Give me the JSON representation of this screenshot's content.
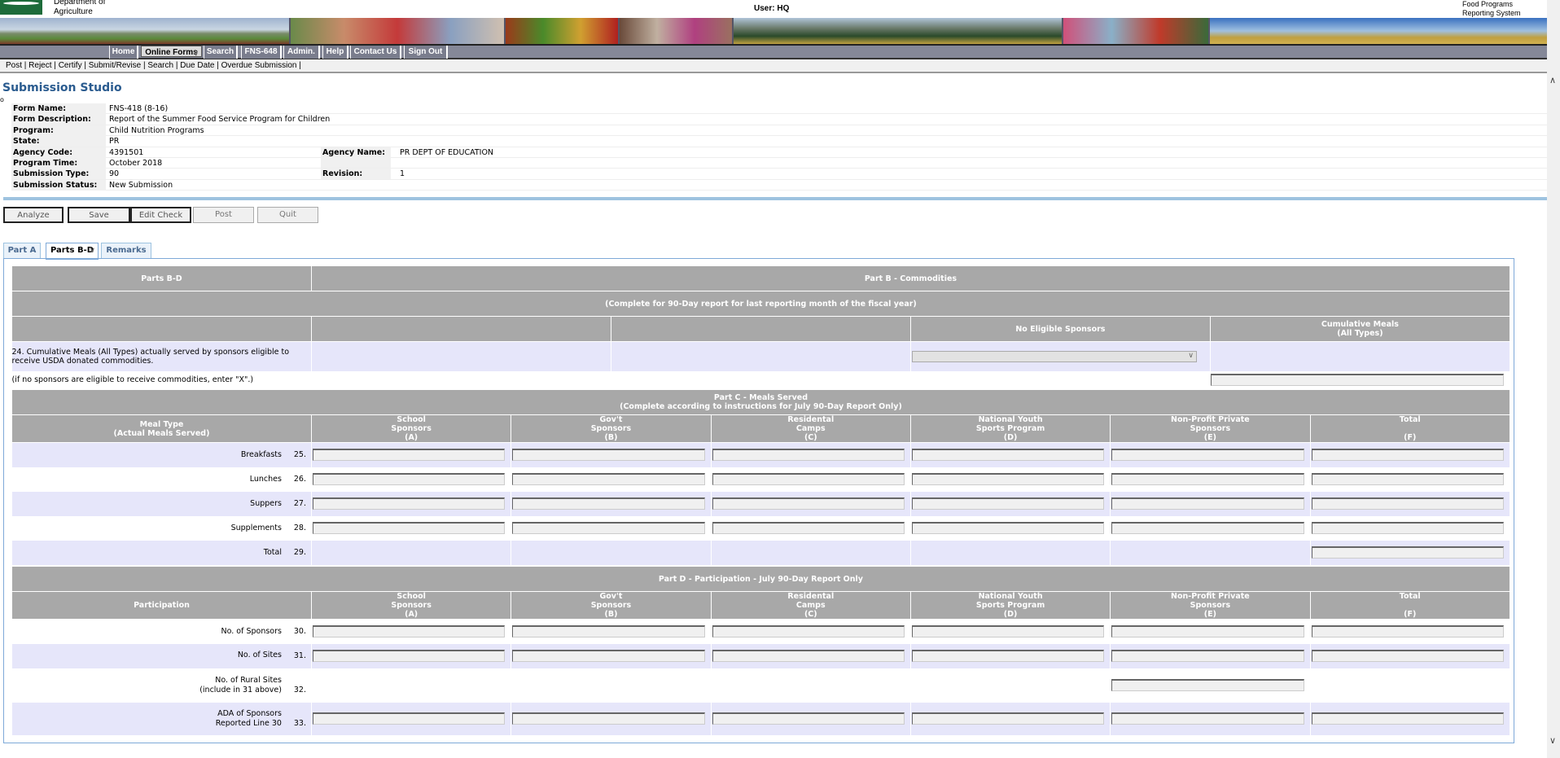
{
  "header": {
    "dept_line1": "Department of",
    "dept_line2": "Agriculture",
    "user": "User: HQ",
    "system_line1": "Food Programs",
    "system_line2": "Reporting System"
  },
  "nav": [
    "Home",
    "Online Forms",
    "Search",
    "FNS-648",
    "Admin.",
    "Help",
    "Contact Us",
    "Sign Out"
  ],
  "subnav": [
    "Post",
    "Reject",
    "Certify",
    "Submit/Revise",
    "Search",
    "Due Date",
    "Overdue Submission"
  ],
  "page_title": "Submission Studio",
  "info": {
    "form_name_label": "Form Name:",
    "form_name": "FNS-418 (8-16)",
    "form_desc_label": "Form Description:",
    "form_desc": "Report of the Summer Food Service Program for Children",
    "program_label": "Program:",
    "program": "Child Nutrition Programs",
    "state_label": "State:",
    "state": "PR",
    "agency_code_label": "Agency Code:",
    "agency_code": "4391501",
    "agency_name_label": "Agency Name:",
    "agency_name": "PR DEPT OF EDUCATION",
    "program_time_label": "Program Time:",
    "program_time": "October 2018",
    "sub_type_label": "Submission Type:",
    "sub_type": "90",
    "revision_label": "Revision:",
    "revision": "1",
    "status_label": "Submission Status:",
    "status": "New Submission"
  },
  "buttons": {
    "analyze": "Analyze",
    "save": "Save",
    "edit_check": "Edit Check",
    "post": "Post",
    "quit": "Quit"
  },
  "tabs": [
    "Part A",
    "Parts B-D",
    "Remarks"
  ],
  "partB": {
    "left_header": "Parts B-D",
    "title": "Part B - Commodities",
    "subtitle": "(Complete for 90-Day report for last reporting month of the fiscal year)",
    "col_no_eligible": "No Eligible Sponsors",
    "col_cumulative": "Cumulative Meals\n(All Types)",
    "line24": "24. Cumulative Meals (All Types) actually served by sponsors eligible to receive USDA donated commodities.",
    "note": "(if no sponsors are eligible to receive commodities, enter \"X\".)"
  },
  "partC": {
    "title": "Part C - Meals Served",
    "subtitle": "(Complete according to instructions for July 90-Day Report Only)",
    "row_header": "Meal Type\n(Actual Meals Served)",
    "rows": [
      {
        "label": "Breakfasts",
        "num": "25."
      },
      {
        "label": "Lunches",
        "num": "26."
      },
      {
        "label": "Suppers",
        "num": "27."
      },
      {
        "label": "Supplements",
        "num": "28."
      },
      {
        "label": "Total",
        "num": "29."
      }
    ]
  },
  "columns": [
    "School\nSponsors\n(A)",
    "Gov't\nSponsors\n(B)",
    "Residental\nCamps\n(C)",
    "National Youth\nSports Program\n(D)",
    "Non-Profit Private\nSponsors\n(E)",
    "Total\n\n(F)"
  ],
  "partD": {
    "title": "Part D - Participation - July 90-Day Report Only",
    "row_header": "Participation",
    "rows": [
      {
        "label": "No. of Sponsors",
        "num": "30."
      },
      {
        "label": "No. of Sites",
        "num": "31."
      },
      {
        "label": "No. of Rural Sites\n(include in 31 above)",
        "num": "32."
      },
      {
        "label": "ADA of Sponsors\nReported Line 30",
        "num": "33."
      }
    ]
  }
}
